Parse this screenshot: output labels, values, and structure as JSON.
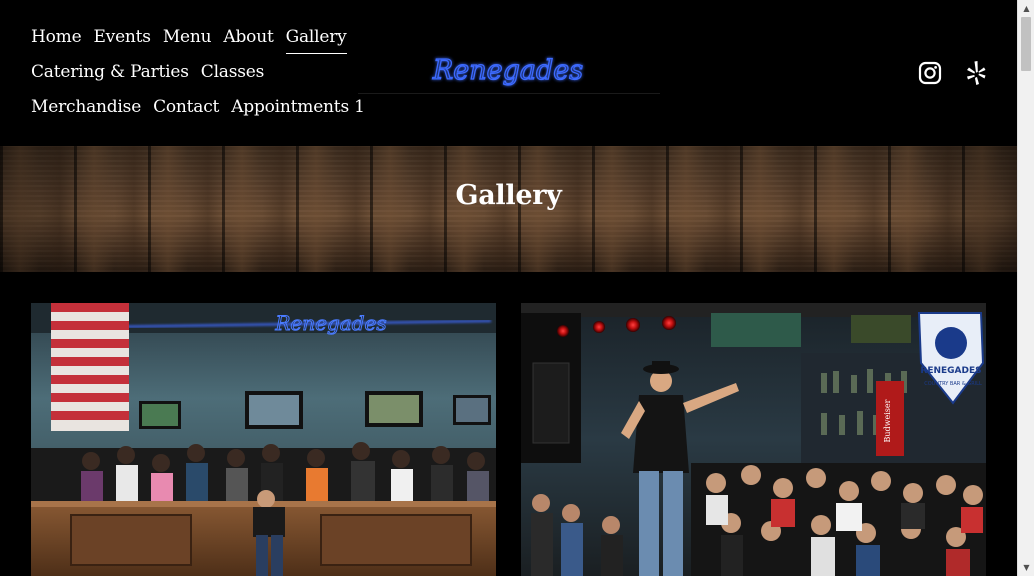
{
  "nav": {
    "rows": [
      [
        {
          "label": "Home"
        },
        {
          "label": "Events"
        },
        {
          "label": "Menu"
        },
        {
          "label": "About"
        },
        {
          "label": "Gallery",
          "active": true
        }
      ],
      [
        {
          "label": "Catering & Parties"
        },
        {
          "label": "Classes"
        }
      ],
      [
        {
          "label": "Merchandise"
        },
        {
          "label": "Contact"
        },
        {
          "label": "Appointments 1"
        }
      ]
    ]
  },
  "logo": {
    "text": "Renegades",
    "color": "#2a5bff"
  },
  "social": {
    "icons": [
      "instagram-icon",
      "yelp-icon"
    ]
  },
  "banner": {
    "title": "Gallery"
  },
  "gallery": {
    "photos": [
      {
        "name": "bar-crowd-photo",
        "sign_text": "Renegades"
      },
      {
        "name": "live-singer-photo",
        "badge_text": "RENEGADES",
        "badge_sub": "COUNTRY BAR & GRILL",
        "sign_text": "Budweiser"
      }
    ]
  },
  "colors": {
    "background": "#000000",
    "text": "#ffffff",
    "neon": "#2a5bff"
  }
}
